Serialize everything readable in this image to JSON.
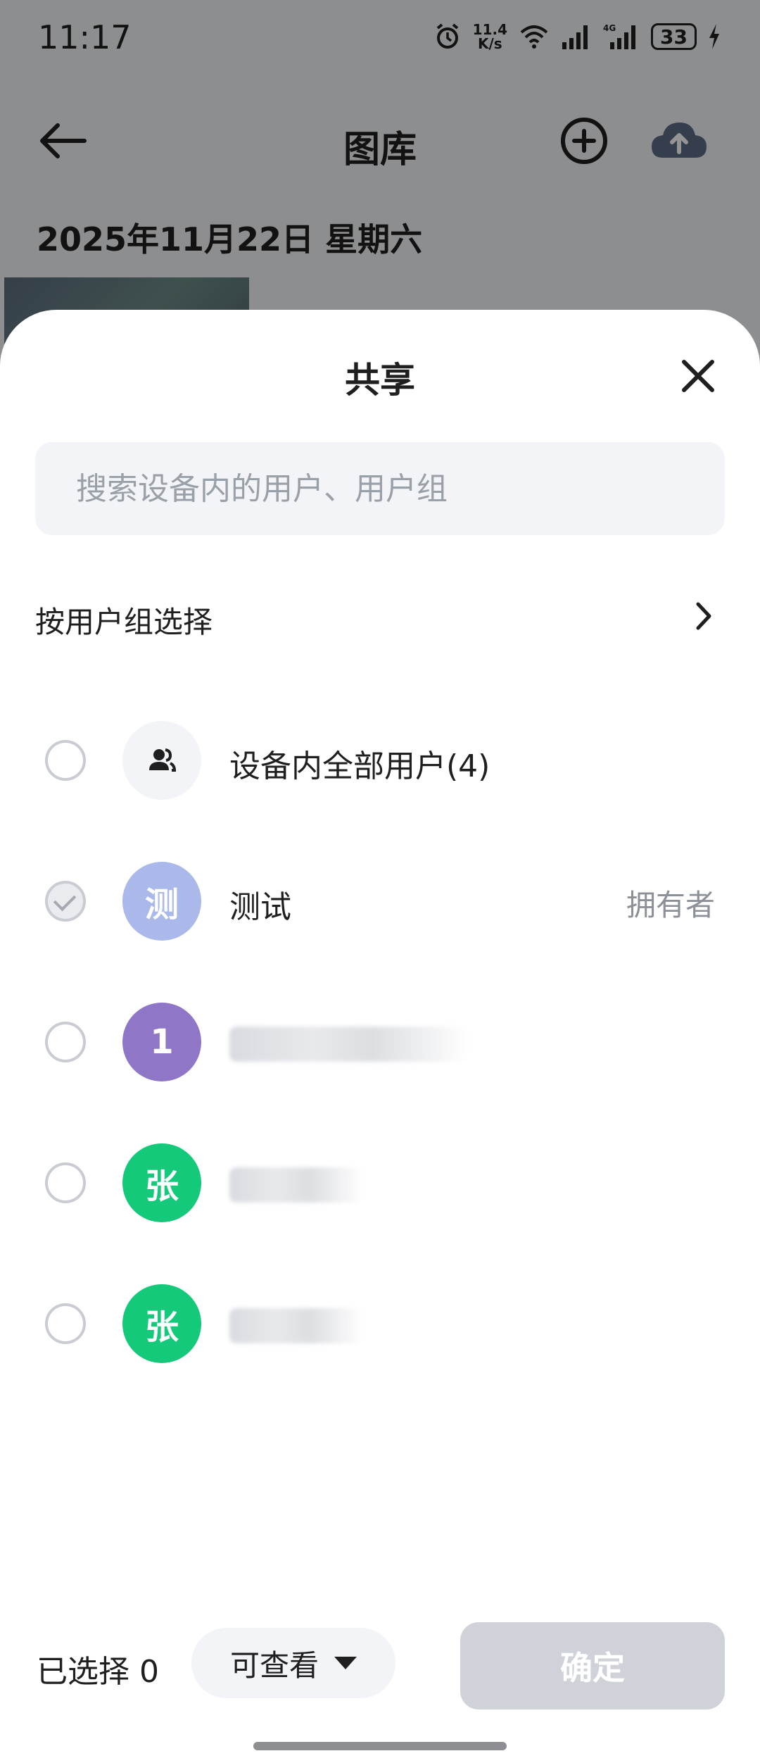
{
  "status_bar": {
    "time": "11:17",
    "net_speed_value": "11.4",
    "net_speed_unit": "K/s",
    "battery": "33"
  },
  "app": {
    "title": "图库",
    "date_heading": "2025年11月22日 星期六"
  },
  "sheet": {
    "title": "共享",
    "search_placeholder": "搜索设备内的用户、用户组",
    "group_select_label": "按用户组选择",
    "users": [
      {
        "avatar": "",
        "name": "设备内全部用户(4)",
        "role": "",
        "avatar_color": "#f3f4f8",
        "icon": "people-icon"
      },
      {
        "avatar": "测",
        "name": "测试",
        "role": "拥有者",
        "avatar_color": "#aab9ea"
      },
      {
        "avatar": "1",
        "name": "",
        "role": "",
        "avatar_color": "#8f76c6"
      },
      {
        "avatar": "张",
        "name": "",
        "role": "",
        "avatar_color": "#15c97a"
      },
      {
        "avatar": "张",
        "name": "",
        "role": "",
        "avatar_color": "#15c97a"
      }
    ]
  },
  "footer": {
    "selected_label": "已选择 0",
    "permission": "可查看",
    "confirm": "确定"
  }
}
